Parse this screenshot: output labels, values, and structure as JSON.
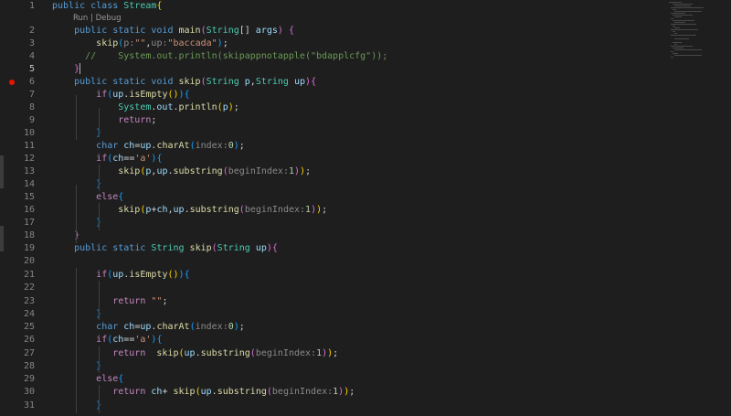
{
  "editor": {
    "codelens": "Run | Debug",
    "lines": [
      {
        "n": "1",
        "toks": [
          [
            "kw",
            "public class "
          ],
          [
            "ty",
            "Stream"
          ],
          [
            "b1",
            "{"
          ]
        ]
      },
      {
        "n": "2",
        "toks": [
          [
            "",
            "    "
          ],
          [
            "kw",
            "public static void "
          ],
          [
            "fn",
            "main"
          ],
          [
            "b2",
            "("
          ],
          [
            "ty",
            "String"
          ],
          [
            "",
            "[] "
          ],
          [
            "var",
            "args"
          ],
          [
            "b2",
            ")"
          ],
          [
            "",
            " "
          ],
          [
            "b2",
            "{"
          ]
        ]
      },
      {
        "n": "3",
        "toks": [
          [
            "",
            "        "
          ],
          [
            "fn",
            "skip"
          ],
          [
            "b3",
            "("
          ],
          [
            "hint",
            "p:"
          ],
          [
            "str",
            "\"\""
          ],
          [
            "",
            ","
          ],
          [
            "hint",
            "up:"
          ],
          [
            "str",
            "\"baccada\""
          ],
          [
            "b3",
            ")"
          ],
          [
            "",
            ";"
          ]
        ]
      },
      {
        "n": "4",
        "toks": [
          [
            "",
            "      "
          ],
          [
            "cmt",
            "//    System.out.println(skipappnotapple(\"bdapplcfg\"));"
          ]
        ]
      },
      {
        "n": "5",
        "toks": [
          [
            "",
            "    "
          ],
          [
            "b2",
            "}"
          ]
        ]
      },
      {
        "n": "6",
        "toks": [
          [
            "",
            "    "
          ],
          [
            "kw",
            "public static void "
          ],
          [
            "fn",
            "skip"
          ],
          [
            "b2",
            "("
          ],
          [
            "ty",
            "String "
          ],
          [
            "var",
            "p"
          ],
          [
            "",
            ","
          ],
          [
            "ty",
            "String "
          ],
          [
            "var",
            "up"
          ],
          [
            "b2",
            ")"
          ],
          [
            "b2",
            "{"
          ]
        ]
      },
      {
        "n": "7",
        "toks": [
          [
            "",
            "        "
          ],
          [
            "ctl",
            "if"
          ],
          [
            "b3",
            "("
          ],
          [
            "var",
            "up"
          ],
          [
            "",
            "."
          ],
          [
            "fn",
            "isEmpty"
          ],
          [
            "b1",
            "()"
          ],
          [
            "b3",
            ")"
          ],
          [
            "b3",
            "{"
          ]
        ]
      },
      {
        "n": "8",
        "toks": [
          [
            "",
            "            "
          ],
          [
            "ty",
            "System"
          ],
          [
            "",
            "."
          ],
          [
            "var",
            "out"
          ],
          [
            "",
            "."
          ],
          [
            "fn",
            "println"
          ],
          [
            "b1",
            "("
          ],
          [
            "var",
            "p"
          ],
          [
            "b1",
            ")"
          ],
          [
            "",
            ";"
          ]
        ]
      },
      {
        "n": "9",
        "toks": [
          [
            "",
            "            "
          ],
          [
            "ctl",
            "return"
          ],
          [
            "",
            ";"
          ]
        ]
      },
      {
        "n": "10",
        "toks": [
          [
            "",
            "        "
          ],
          [
            "b3",
            "}"
          ]
        ]
      },
      {
        "n": "11",
        "toks": [
          [
            "",
            "        "
          ],
          [
            "kw",
            "char "
          ],
          [
            "var",
            "ch"
          ],
          [
            "",
            "="
          ],
          [
            "var",
            "up"
          ],
          [
            "",
            "."
          ],
          [
            "fn",
            "charAt"
          ],
          [
            "b3",
            "("
          ],
          [
            "hint",
            "index:"
          ],
          [
            "num",
            "0"
          ],
          [
            "b3",
            ")"
          ],
          [
            "",
            ";"
          ]
        ]
      },
      {
        "n": "12",
        "toks": [
          [
            "",
            "        "
          ],
          [
            "ctl",
            "if"
          ],
          [
            "b3",
            "("
          ],
          [
            "var",
            "ch"
          ],
          [
            "",
            "=="
          ],
          [
            "str",
            "'a'"
          ],
          [
            "b3",
            ")"
          ],
          [
            "b3",
            "{"
          ]
        ]
      },
      {
        "n": "13",
        "toks": [
          [
            "",
            "            "
          ],
          [
            "fn",
            "skip"
          ],
          [
            "b1",
            "("
          ],
          [
            "var",
            "p"
          ],
          [
            "",
            ","
          ],
          [
            "var",
            "up"
          ],
          [
            "",
            "."
          ],
          [
            "fn",
            "substring"
          ],
          [
            "b2",
            "("
          ],
          [
            "hint",
            "beginIndex:"
          ],
          [
            "num",
            "1"
          ],
          [
            "b2",
            ")"
          ],
          [
            "b1",
            ")"
          ],
          [
            "",
            ";"
          ]
        ]
      },
      {
        "n": "14",
        "toks": [
          [
            "",
            "        "
          ],
          [
            "b3",
            "}"
          ]
        ]
      },
      {
        "n": "15",
        "toks": [
          [
            "",
            "        "
          ],
          [
            "ctl",
            "else"
          ],
          [
            "b3",
            "{"
          ]
        ]
      },
      {
        "n": "16",
        "toks": [
          [
            "",
            "            "
          ],
          [
            "fn",
            "skip"
          ],
          [
            "b1",
            "("
          ],
          [
            "var",
            "p"
          ],
          [
            "",
            "+"
          ],
          [
            "var",
            "ch"
          ],
          [
            "",
            ","
          ],
          [
            "var",
            "up"
          ],
          [
            "",
            "."
          ],
          [
            "fn",
            "substring"
          ],
          [
            "b2",
            "("
          ],
          [
            "hint",
            "beginIndex:"
          ],
          [
            "num",
            "1"
          ],
          [
            "b2",
            ")"
          ],
          [
            "b1",
            ")"
          ],
          [
            "",
            ";"
          ]
        ]
      },
      {
        "n": "17",
        "toks": [
          [
            "",
            "        "
          ],
          [
            "b3",
            "}"
          ]
        ]
      },
      {
        "n": "18",
        "toks": [
          [
            "",
            "    "
          ],
          [
            "b2",
            "}"
          ]
        ]
      },
      {
        "n": "19",
        "toks": [
          [
            "",
            "    "
          ],
          [
            "kw",
            "public static "
          ],
          [
            "ty",
            "String "
          ],
          [
            "fn",
            "skip"
          ],
          [
            "b2",
            "("
          ],
          [
            "ty",
            "String "
          ],
          [
            "var",
            "up"
          ],
          [
            "b2",
            ")"
          ],
          [
            "b2",
            "{"
          ]
        ]
      },
      {
        "n": "20",
        "toks": []
      },
      {
        "n": "21",
        "toks": [
          [
            "",
            "        "
          ],
          [
            "ctl",
            "if"
          ],
          [
            "b3",
            "("
          ],
          [
            "var",
            "up"
          ],
          [
            "",
            "."
          ],
          [
            "fn",
            "isEmpty"
          ],
          [
            "b1",
            "()"
          ],
          [
            "b3",
            ")"
          ],
          [
            "b3",
            "{"
          ]
        ]
      },
      {
        "n": "22",
        "toks": []
      },
      {
        "n": "23",
        "toks": [
          [
            "",
            "           "
          ],
          [
            "ctl",
            "return "
          ],
          [
            "str",
            "\"\""
          ],
          [
            "",
            ";"
          ]
        ]
      },
      {
        "n": "24",
        "toks": [
          [
            "",
            "        "
          ],
          [
            "b3",
            "}"
          ]
        ]
      },
      {
        "n": "25",
        "toks": [
          [
            "",
            "        "
          ],
          [
            "kw",
            "char "
          ],
          [
            "var",
            "ch"
          ],
          [
            "",
            "="
          ],
          [
            "var",
            "up"
          ],
          [
            "",
            "."
          ],
          [
            "fn",
            "charAt"
          ],
          [
            "b3",
            "("
          ],
          [
            "hint",
            "index:"
          ],
          [
            "num",
            "0"
          ],
          [
            "b3",
            ")"
          ],
          [
            "",
            ";"
          ]
        ]
      },
      {
        "n": "26",
        "toks": [
          [
            "",
            "        "
          ],
          [
            "ctl",
            "if"
          ],
          [
            "b3",
            "("
          ],
          [
            "var",
            "ch"
          ],
          [
            "",
            "=="
          ],
          [
            "str",
            "'a'"
          ],
          [
            "b3",
            ")"
          ],
          [
            "b3",
            "{"
          ]
        ]
      },
      {
        "n": "27",
        "toks": [
          [
            "",
            "           "
          ],
          [
            "ctl",
            "return  "
          ],
          [
            "fn",
            "skip"
          ],
          [
            "b1",
            "("
          ],
          [
            "var",
            "up"
          ],
          [
            "",
            "."
          ],
          [
            "fn",
            "substring"
          ],
          [
            "b2",
            "("
          ],
          [
            "hint",
            "beginIndex:"
          ],
          [
            "num",
            "1"
          ],
          [
            "b2",
            ")"
          ],
          [
            "b1",
            ")"
          ],
          [
            "",
            ";"
          ]
        ]
      },
      {
        "n": "28",
        "toks": [
          [
            "",
            "        "
          ],
          [
            "b3",
            "}"
          ]
        ]
      },
      {
        "n": "29",
        "toks": [
          [
            "",
            "        "
          ],
          [
            "ctl",
            "else"
          ],
          [
            "b3",
            "{"
          ]
        ]
      },
      {
        "n": "30",
        "toks": [
          [
            "",
            "           "
          ],
          [
            "ctl",
            "return "
          ],
          [
            "var",
            "ch"
          ],
          [
            "",
            "+ "
          ],
          [
            "fn",
            "skip"
          ],
          [
            "b1",
            "("
          ],
          [
            "var",
            "up"
          ],
          [
            "",
            "."
          ],
          [
            "fn",
            "substring"
          ],
          [
            "b2",
            "("
          ],
          [
            "hint",
            "beginIndex:"
          ],
          [
            "num",
            "1"
          ],
          [
            "b2",
            ")"
          ],
          [
            "b1",
            ")"
          ],
          [
            "",
            ";"
          ]
        ]
      },
      {
        "n": "31",
        "toks": [
          [
            "",
            "        "
          ],
          [
            "b3",
            "}"
          ]
        ]
      }
    ],
    "active_line": "5",
    "breakpoint_line": "6"
  },
  "colors": {
    "background": "#1e1e1e",
    "keyword": "#569cd6",
    "control": "#c586c0",
    "type": "#4ec9b0",
    "function": "#dcdcaa",
    "variable": "#9cdcfe",
    "string": "#ce9178",
    "number": "#b5cea8",
    "comment": "#6a9955",
    "breakpoint": "#e51400"
  }
}
